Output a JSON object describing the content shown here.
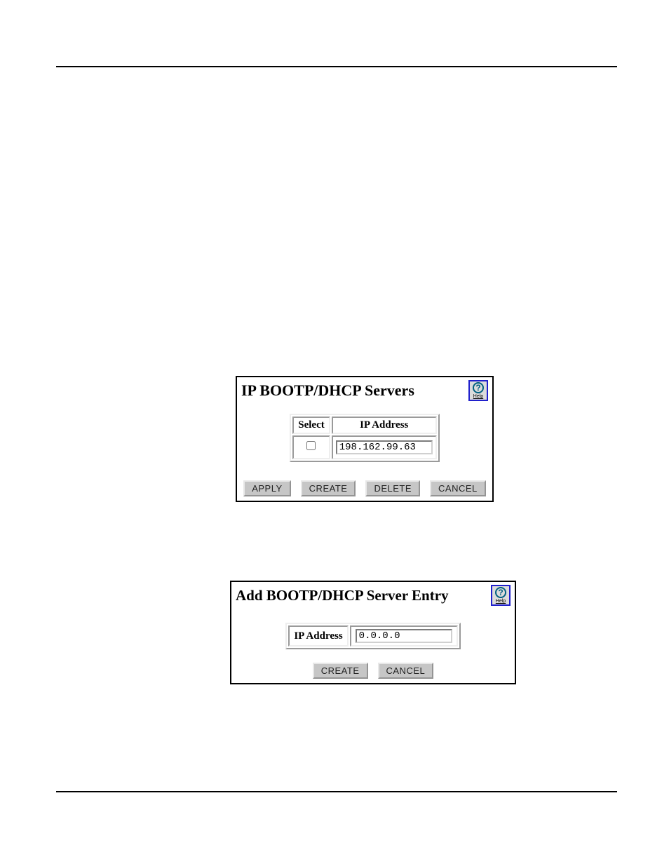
{
  "dialog1": {
    "title": "IP BOOTP/DHCP Servers",
    "help_label": "Help",
    "table": {
      "col_select": "Select",
      "col_ip": "IP Address",
      "row_ip": "198.162.99.63"
    },
    "buttons": {
      "apply": "APPLY",
      "create": "CREATE",
      "delete": "DELETE",
      "cancel": "CANCEL"
    }
  },
  "dialog2": {
    "title": "Add BOOTP/DHCP Server Entry",
    "help_label": "Help",
    "row_label": "IP Address",
    "ip_value": "0.0.0.0",
    "buttons": {
      "create": "CREATE",
      "cancel": "CANCEL"
    }
  }
}
